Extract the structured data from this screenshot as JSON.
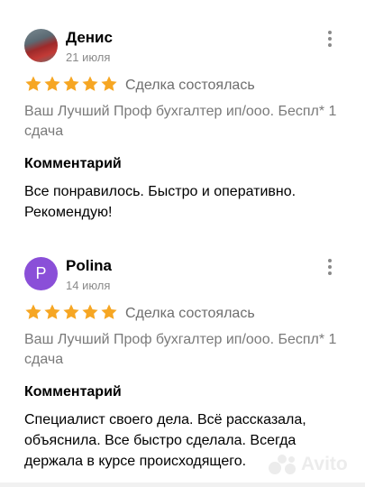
{
  "reviews": [
    {
      "name": "Денис",
      "date": "21 июля",
      "rating": 5,
      "deal_status": "Сделка состоялась",
      "service": "Ваш Лучший Проф бухгалтер ип/ооо. Беспл* 1 сдача",
      "comment_title": "Комментарий",
      "comment": "Все понравилось. Быстро и оперативно. Рекомендую!",
      "avatar_type": "photo"
    },
    {
      "name": "Polina",
      "date": "14 июля",
      "rating": 5,
      "deal_status": "Сделка состоялась",
      "service": "Ваш Лучший Проф бухгалтер ип/ооо. Беспл* 1 сдача",
      "comment_title": "Комментарий",
      "comment": "Специалист своего дела. Всё рассказала, объяснила. Все быстро сделала. Всегда держала в курсе происходящего.",
      "avatar_type": "letter",
      "avatar_letter": "P",
      "avatar_color": "#8a4fd8"
    }
  ],
  "colors": {
    "star": "#f6a623",
    "muted_text": "#8a8a8a"
  },
  "icons": {
    "more": "more-vertical-icon",
    "star": "star-icon"
  },
  "watermark": "Avito"
}
